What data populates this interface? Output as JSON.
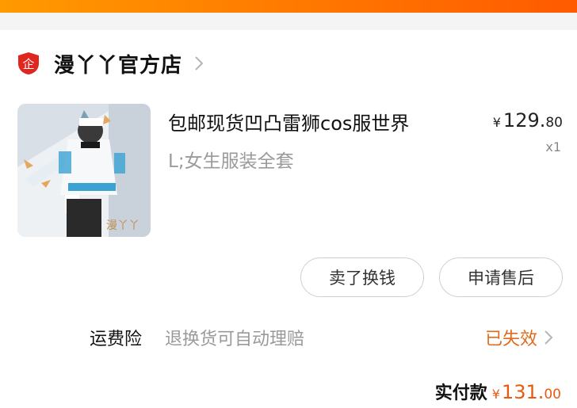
{
  "colors": {
    "accent_gradient_start": "#ff9a00",
    "accent_gradient_end": "#ff5a00",
    "status_orange": "#e06b1a"
  },
  "shop": {
    "badge_text": "企",
    "name": "漫丫丫官方店",
    "icon": "chevron-right-icon"
  },
  "product": {
    "title": "包邮现货凹凸雷狮cos服世界",
    "variant": "L;女生服装全套",
    "price_symbol": "¥",
    "price_int": "129.",
    "price_dec": "80",
    "quantity": "x1",
    "image_watermark": "漫丫丫"
  },
  "actions": {
    "sell_label": "卖了换钱",
    "after_sale_label": "申请售后"
  },
  "insurance": {
    "label": "运费险",
    "description": "退换货可自动理赔",
    "status": "已失效"
  },
  "payment": {
    "label": "实付款",
    "symbol": "¥",
    "int": "131.",
    "dec": "00"
  }
}
